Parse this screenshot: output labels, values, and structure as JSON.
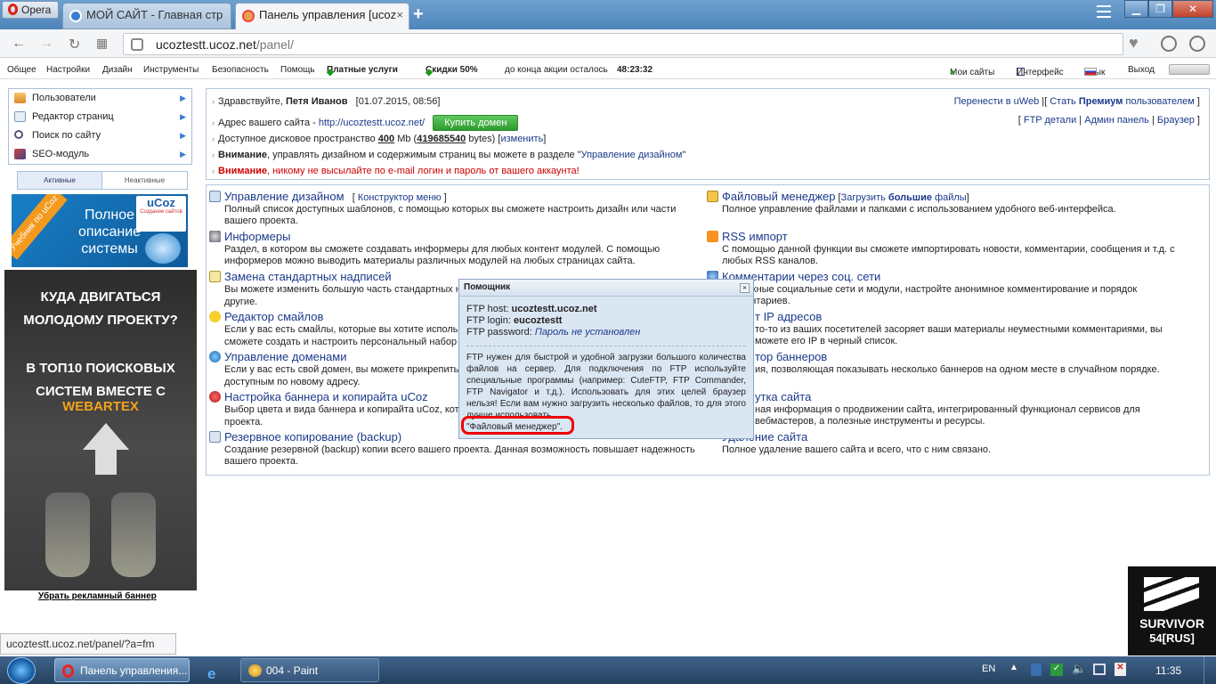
{
  "browser": {
    "menu_label": "Opera",
    "tabs": [
      {
        "title": "МОЙ САЙТ - Главная стр"
      },
      {
        "title": "Панель управления [ucoz"
      }
    ],
    "url_host": "ucoztestt.ucoz.net",
    "url_path": "/panel/",
    "status_url": "ucoztestt.ucoz.net/panel/?a=fm"
  },
  "topmenu": {
    "items": [
      "Общее",
      "Настройки",
      "Дизайн",
      "Инструменты",
      "Безопасность",
      "Помощь"
    ],
    "paid": "Платные услуги",
    "discount": "Скидки 50%",
    "promo_text": "до конца акции осталось",
    "timer": "48:23:32",
    "my_sites": "Мои сайты",
    "interface": "Интерфейс",
    "language": "Язык",
    "logout": "Выход"
  },
  "sidebar": {
    "items": [
      {
        "label": "Пользователи"
      },
      {
        "label": "Редактор страниц"
      },
      {
        "label": "Поиск по сайту"
      },
      {
        "label": "SEO-модуль"
      }
    ],
    "tabs": [
      "Активные",
      "Неактивные"
    ],
    "ucoz_banner": {
      "ribbon": "Учебник по uCoz",
      "line1": "Полное",
      "line2": "описание",
      "line3": "системы",
      "brand": "uCoz",
      "sub": "Создание сайтов"
    },
    "web_banner": {
      "line1": "КУДА ДВИГАТЬСЯ",
      "line2": "МОЛОДОМУ ПРОЕКТУ?",
      "line3": "В ТОП10 ПОИСКОВЫХ",
      "line4": "СИСТЕМ ВМЕСТЕ С",
      "brand": "WEBARTEX"
    },
    "remove_ad": "Убрать рекламный баннер"
  },
  "info": {
    "greeting": "Здравствуйте,",
    "user": "Петя Иванов",
    "datetime": "[01.07.2015, 08:56]",
    "address_label": "Адрес вашего сайта -",
    "address": "http://ucoztestt.ucoz.net/",
    "buy_domain": "Купить домен",
    "disk_label": "Доступное дисковое пространство",
    "disk_mb": "400",
    "disk_mb_unit": "Mb",
    "disk_bytes": "419685540",
    "disk_bytes_unit": "bytes",
    "change": "изменить",
    "warn1_label": "Внимание",
    "warn1_text": ", управлять дизайном и содержимым страниц вы можете в разделе \"",
    "warn1_link": "Управление дизайном",
    "warn2_label": "Внимание",
    "warn2_text": ", никому не высылайте по e-mail логин и пароль от вашего аккаунта!",
    "move_uweb": "Перенести в uWeb",
    "become_premium_pre": "Стать",
    "premium": "Премиум",
    "become_premium_post": "пользователем",
    "ftp_details": "FTP детали",
    "admin_panel": "Админ панель",
    "browser": "Браузер"
  },
  "sections_left": [
    {
      "title": "Управление дизайном",
      "extra": "Конструктор меню",
      "desc": "Полный список доступных шаблонов, с помощью которых вы сможете настроить дизайн или части вашего проекта."
    },
    {
      "title": "Информеры",
      "desc": "Раздел, в котором вы сможете создавать информеры для любых контент модулей. С помощью информеров можно выводить материалы различных модулей на любых страницах сайта."
    },
    {
      "title": "Замена стандартных надписей",
      "desc": "Вы можете изменить большую часть стандартных н"
    },
    {
      "title": "Редактор смайлов",
      "desc": "Если у вас есть смайлы, которые вы хотите исполь"
    },
    {
      "title": "Управление доменами",
      "desc": "Если у вас есть свой домен, вы можете прикрепить"
    },
    {
      "title": "Настройка баннера и копирайта uCoz",
      "desc": "Выбор цвета и вида баннера и копирайта uCoz, кот"
    },
    {
      "title": "Резервное копирование (backup)",
      "desc": "Создание резервной (backup) копии всего вашего проекта. Данная возможность повышает надежность вашего проекта."
    }
  ],
  "sections_left_extra": [
    "другие.",
    "сможете создать и настроить персональный набор",
    "доступным по новому адресу.",
    "проекта."
  ],
  "sections_right": [
    {
      "title": "Файловый менеджер",
      "extra_pre": "Загрузить",
      "extra_bold": "большие",
      "extra_post": "файлы",
      "desc": "Полное управление файлами и папками с использованием удобного веб-интерфейса."
    },
    {
      "title": "RSS импорт",
      "desc": "С помощью данной функции вы сможете импортировать новости, комментарии, сообщения и т.д. с любых RSS каналов."
    },
    {
      "title": "Комментарии через соц. сети",
      "desc": "сте нужные социальные сети и модули, настройте анонимное комментирование и порядок комментариев."
    },
    {
      "title": "т IP адресов",
      "desc": "то-то из ваших посетителей засоряет ваши материалы неуместными комментариями, вы можете его IP в черный список."
    },
    {
      "title": "тор баннеров",
      "desc": "ия, позволяющая показывать несколько баннеров на одном месте в случайном порядке."
    },
    {
      "title": "утка сайта",
      "desc": "ная информация о продвижении сайта, интегрированный функционал сервисов для вебмастеров, а полезные инструменты и ресурсы."
    },
    {
      "title": "Удаление сайта",
      "desc": "Полное удаление вашего сайта и всего, что с ним связано."
    }
  ],
  "popup": {
    "title": "Помощник",
    "close": "×",
    "host_label": "FTP host:",
    "host": "ucoztestt.ucoz.net",
    "login_label": "FTP login:",
    "login": "eucoztestt",
    "password_label": "FTP password:",
    "password": "Пароль не установлен",
    "text": "FTP нужен для быстрой и удобной загрузки большого количества файлов на сервер. Для подключения по FTP используйте специальные программы (например: CuteFTP, FTP Commander, FTP Navigator и т.д.). Использовать для этих целей браузер нельзя! Если вам нужно загрузить несколько файлов, то для этого лучше использовать",
    "fm_link": "\"Файловый менеджер\"."
  },
  "taskbar": {
    "items": [
      "Панель управления...",
      "004 - Paint"
    ],
    "lang": "EN",
    "clock": "11:35"
  },
  "watermark": {
    "line1": "SURVIVOR",
    "line2": "54[RUS]"
  },
  "colors": {
    "accent": "#1a3a8a",
    "warning": "#cc0000",
    "buy_button": "#3aa83a",
    "highlight": "#ee0000"
  }
}
